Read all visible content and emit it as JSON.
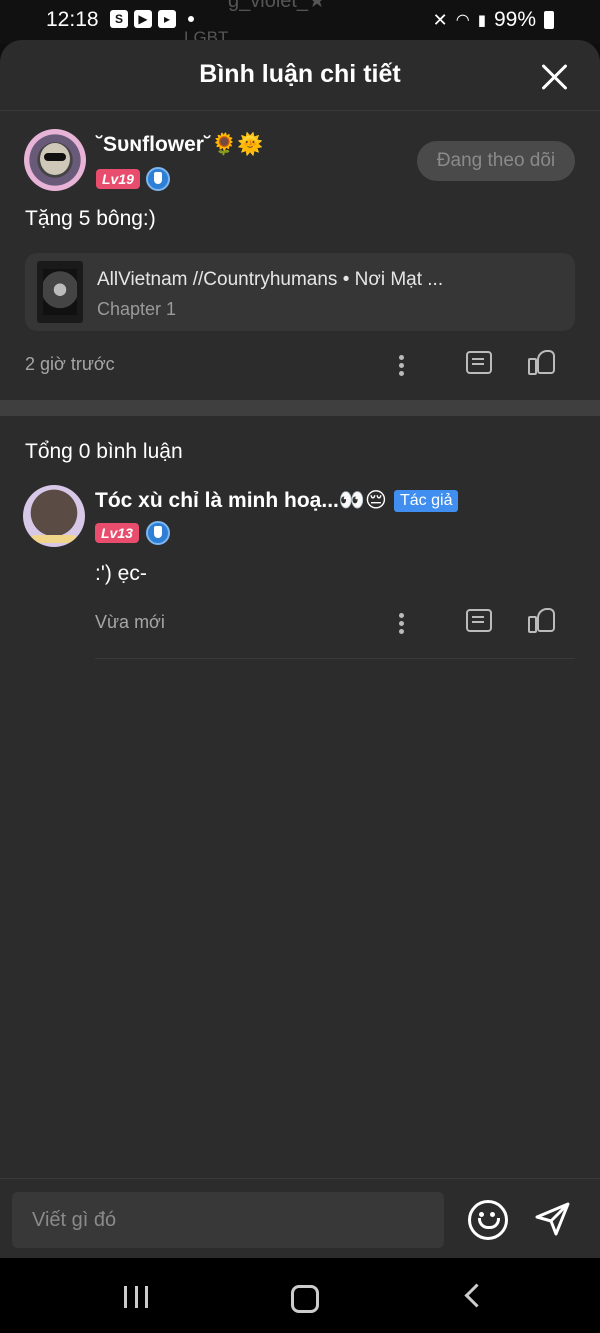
{
  "status_bar": {
    "time": "12:18",
    "battery": "99%",
    "backdrop_top": "g_violet_★",
    "backdrop_lgbt": "LGBT"
  },
  "sheet": {
    "title": "Bình luận chi tiết"
  },
  "post": {
    "username": "˘Sᴜɴflower˘🌻🌞",
    "level": "Lv19",
    "follow_label": "Đang theo dõi",
    "text": "Tặng 5 bông:)",
    "story_title": "AllVietnam //Countryhumans • Nơi Mạt ...",
    "story_chapter": "Chapter 1",
    "time": "2 giờ trước"
  },
  "replies_header": {
    "total": "Tổng 0 bình luận"
  },
  "reply": {
    "username": "Tóc xù chỉ là minh hoạ...👀😔",
    "author_tag": "Tác giả",
    "level": "Lv13",
    "text": ":') ẹc-",
    "time": "Vừa mới"
  },
  "input": {
    "placeholder": "Viết gì đó"
  },
  "colors": {
    "sheet_bg": "#2c2c2c",
    "level_badge": "#e84d6e",
    "author_tag": "#3f8ef0",
    "shield_badge": "#2e7fd6"
  }
}
